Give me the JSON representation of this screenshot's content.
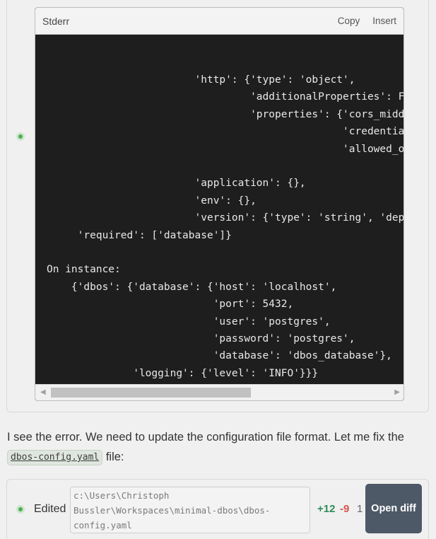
{
  "output": {
    "title": "Stderr",
    "copy_label": "Copy",
    "insert_label": "Insert",
    "code_lines": [
      "                        'http': {'type': 'object',",
      "                                 'additionalProperties': False,",
      "                                 'properties': {'cors_middleware'",
      "                                                'credentials'",
      "                                                'allowed_origins'",
      "",
      "                        'application': {},",
      "                        'env': {},",
      "                        'version': {'type': 'string', 'deprecated'",
      "     'required': ['database']}",
      "",
      "On instance:",
      "    {'dbos': {'database': {'host': 'localhost',",
      "                           'port': 5432,",
      "                           'user': 'postgres',",
      "                           'password': 'postgres',",
      "                           'database': 'dbos_database'},",
      "              'logging': {'level': 'INFO'}}}"
    ]
  },
  "message": {
    "text_before": "I see the error. We need to update the configuration file format. Let me fix the ",
    "code": "dbos-config.yaml",
    "text_after": " file:"
  },
  "edit": {
    "status": "Edited",
    "path": "c:\\Users\\Christoph\nBussler\\Workspaces\\minimal-dbos\\dbos-\nconfig.yaml",
    "additions": "+12",
    "deletions": "-9",
    "count": "1",
    "open_diff_label": "Open diff"
  }
}
